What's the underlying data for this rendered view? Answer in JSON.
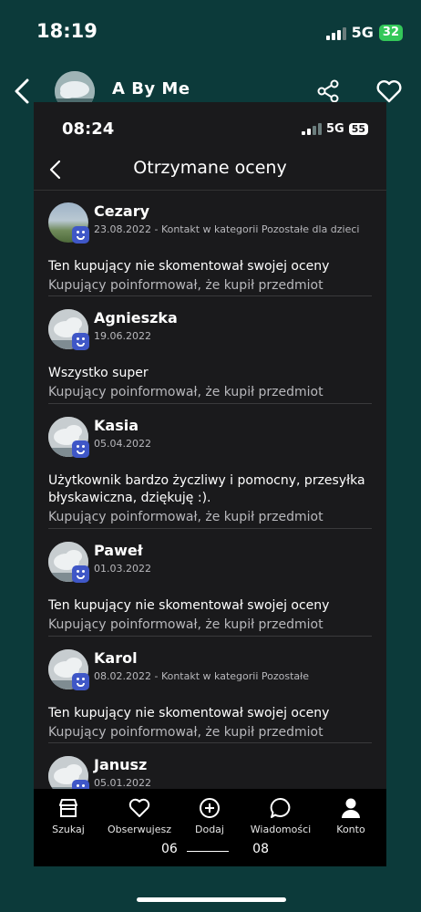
{
  "outer_status": {
    "time": "18:19",
    "network": "5G",
    "battery": "32"
  },
  "header": {
    "title": "A  By Me"
  },
  "inner_status": {
    "time": "08:24",
    "network": "5G",
    "battery": "55"
  },
  "screen": {
    "title": "Otrzymane oceny"
  },
  "reviews": [
    {
      "name": "Cezary",
      "meta": "23.08.2022 - Kontakt w kategorii Pozostałe dla dzieci",
      "comment": "Ten kupujący nie skomentował swojej oceny",
      "info": "Kupujący poinformował, że kupił przedmiot"
    },
    {
      "name": "Agnieszka",
      "meta": "19.06.2022",
      "comment": "Wszystko super",
      "info": "Kupujący poinformował, że kupił przedmiot"
    },
    {
      "name": "Kasia",
      "meta": "05.04.2022",
      "comment": "Użytkownik bardzo życzliwy i pomocny, przesyłka błyskawiczna, dziękuję :).",
      "info": "Kupujący poinformował, że kupił przedmiot"
    },
    {
      "name": "Paweł",
      "meta": "01.03.2022",
      "comment": "Ten kupujący nie skomentował swojej oceny",
      "info": "Kupujący poinformował, że kupił przedmiot"
    },
    {
      "name": "Karol",
      "meta": "08.02.2022 - Kontakt w kategorii Pozostałe",
      "comment": "Ten kupujący nie skomentował swojej oceny",
      "info": "Kupujący poinformował, że kupił przedmiot"
    },
    {
      "name": "Janusz",
      "meta": "05.01.2022",
      "comment": "",
      "info": ""
    }
  ],
  "tabs": [
    {
      "label": "Szukaj",
      "icon": "shop-icon"
    },
    {
      "label": "Obserwujesz",
      "icon": "heart-icon"
    },
    {
      "label": "Dodaj",
      "icon": "plus-circle-icon"
    },
    {
      "label": "Wiadomości",
      "icon": "chat-icon"
    },
    {
      "label": "Konto",
      "icon": "person-icon"
    }
  ],
  "scrubber": {
    "start": "06",
    "end": "08"
  }
}
